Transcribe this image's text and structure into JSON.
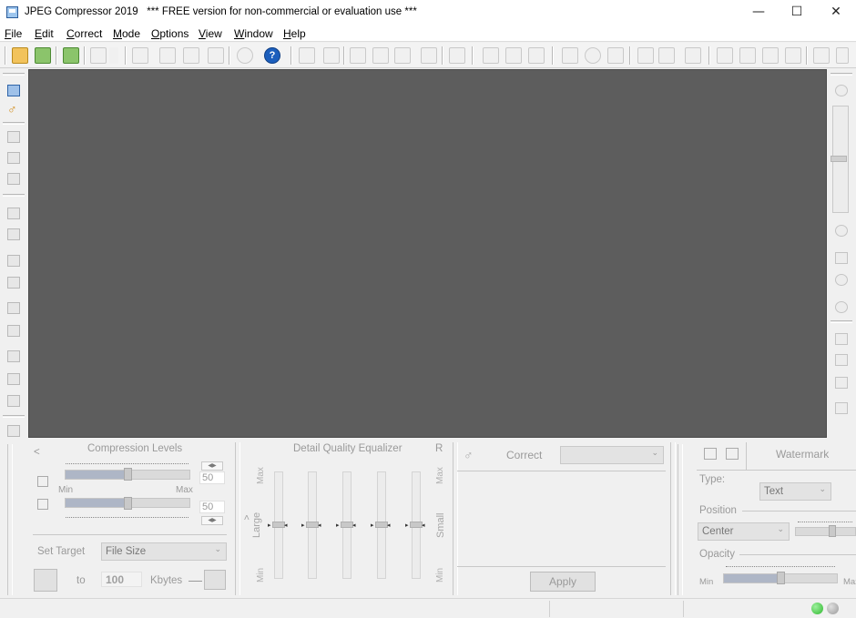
{
  "window": {
    "title": "JPEG Compressor 2019",
    "notice": "*** FREE version for non-commercial or evaluation use ***",
    "minimize_glyph": "—",
    "maximize_glyph": "☐",
    "close_glyph": "✕"
  },
  "menu": [
    {
      "label": "File",
      "accel": "F",
      "rest": "ile"
    },
    {
      "label": "Edit",
      "accel": "E",
      "rest": "dit"
    },
    {
      "label": "Correct",
      "accel": "C",
      "rest": "orrect"
    },
    {
      "label": "Mode",
      "accel": "M",
      "rest": "ode"
    },
    {
      "label": "Options",
      "accel": "O",
      "rest": "ptions"
    },
    {
      "label": "View",
      "accel": "V",
      "rest": "iew"
    },
    {
      "label": "Window",
      "accel": "W",
      "rest": "indow"
    },
    {
      "label": "Help",
      "accel": "H",
      "rest": "elp"
    }
  ],
  "toolbar": {
    "help_glyph": "?"
  },
  "compression": {
    "collapse_glyph": "<",
    "title": "Compression Levels",
    "top_value": "50",
    "min_label": "Min",
    "max_label": "Max",
    "bottom_value": "50",
    "top_level_fraction": 0.5,
    "bottom_level_fraction": 0.5,
    "set_target_label": "Set Target",
    "target_type": "File Size",
    "to_label": "to",
    "target_value": "100",
    "unit_label": "Kbytes"
  },
  "equalizer": {
    "title": "Detail Quality Equalizer",
    "reset_label": "R",
    "max_left": "Max",
    "min_left": "Min",
    "max_right": "Max",
    "min_right": "Min",
    "large_label": "Large",
    "small_label": "Small",
    "arrow_glyph": "<",
    "band_levels": [
      0.5,
      0.5,
      0.5,
      0.5,
      0.5
    ]
  },
  "correct": {
    "title": "Correct",
    "select_value": "",
    "apply_label": "Apply"
  },
  "watermark": {
    "title": "Watermark",
    "type_label": "Type:",
    "type_value": "Text",
    "position_label": "Position",
    "position_value": "Center",
    "opacity_label": "Opacity",
    "opacity_min": "Min",
    "opacity_max": "Max",
    "opacity_fraction": 0.5
  },
  "status": {
    "led_left_color": "#2fb82f",
    "led_right_color": "#9a9a9a"
  }
}
